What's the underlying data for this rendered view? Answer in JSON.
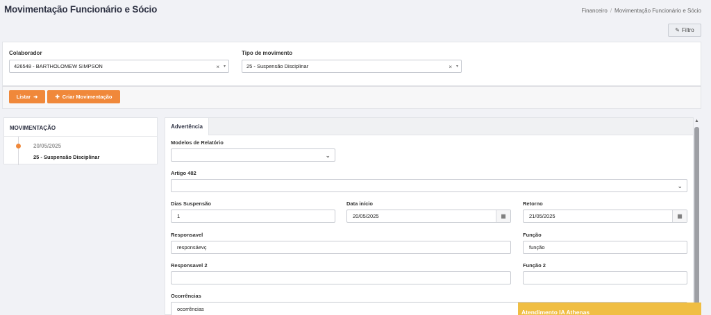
{
  "page_title": "Movimentação Funcionário e Sócio",
  "breadcrumb": {
    "items": [
      "Financeiro",
      "Movimentação Funcionário e Sócio"
    ],
    "separator": "/"
  },
  "filter_button": {
    "label": "Filtro",
    "icon": "edit-icon"
  },
  "filters": {
    "colaborador": {
      "label": "Colaborador",
      "value": "426548 - BARTHOLOMEW SIMPSON"
    },
    "tipo_movimento": {
      "label": "Tipo de movimento",
      "value": "25 - Suspensão Disciplinar"
    },
    "clear_glyph": "×"
  },
  "actions": {
    "listar": "Listar",
    "criar": "Criar Movimentação"
  },
  "sidebar": {
    "title": "MOVIMENTAÇÃO",
    "items": [
      {
        "date": "20/05/2025",
        "text": "25 - Suspensão Disciplinar"
      }
    ]
  },
  "tabs": [
    "Advertência"
  ],
  "form": {
    "modelos": {
      "label": "Modelos de Relatório",
      "value": ""
    },
    "artigo": {
      "label": "Artigo 482",
      "value": ""
    },
    "dias": {
      "label": "Dias Suspensão",
      "value": "1"
    },
    "data_inicio": {
      "label": "Data início",
      "value": "20/05/2025"
    },
    "retorno": {
      "label": "Retorno",
      "value": "21/05/2025"
    },
    "responsavel": {
      "label": "Responsavel",
      "value": "responsáevç"
    },
    "funcao": {
      "label": "Função",
      "value": "função"
    },
    "responsavel2": {
      "label": "Responsavel 2",
      "value": ""
    },
    "funcao2": {
      "label": "Função 2",
      "value": ""
    },
    "ocorrencias": {
      "label": "Ocorrências",
      "value": "ocorrências"
    }
  },
  "chat": {
    "label": "Atendimento IA Athenas"
  },
  "colors": {
    "accent": "#f0883a",
    "chat": "#f0be43"
  }
}
